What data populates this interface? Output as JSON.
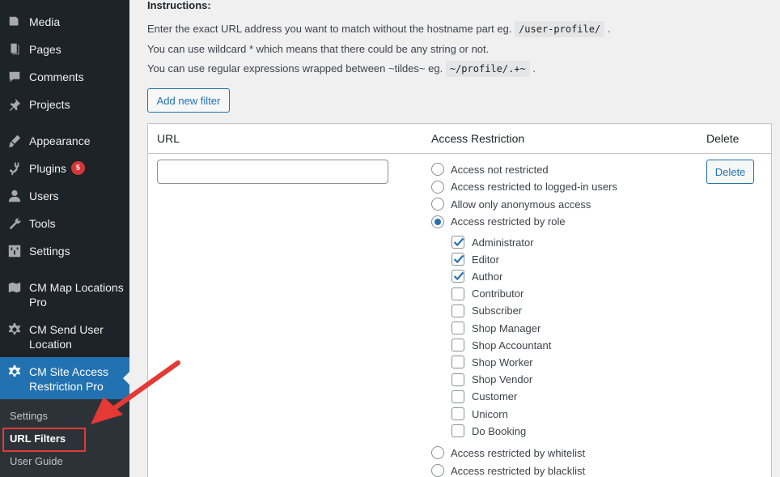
{
  "sidebar": {
    "items": [
      {
        "label": "Media",
        "icon": "media-icon"
      },
      {
        "label": "Pages",
        "icon": "pages-icon"
      },
      {
        "label": "Comments",
        "icon": "comments-icon"
      },
      {
        "label": "Projects",
        "icon": "pin-icon"
      },
      {
        "label": "Appearance",
        "icon": "brush-icon"
      },
      {
        "label": "Plugins",
        "icon": "plugin-icon",
        "badge": "5"
      },
      {
        "label": "Users",
        "icon": "user-icon"
      },
      {
        "label": "Tools",
        "icon": "wrench-icon"
      },
      {
        "label": "Settings",
        "icon": "settings-sliders-icon"
      },
      {
        "label": "CM Map Locations Pro",
        "icon": "map-icon"
      },
      {
        "label": "CM Send User Location",
        "icon": "gear-icon"
      },
      {
        "label": "CM Site Access Restriction Pro",
        "icon": "gear-icon"
      }
    ],
    "submenu": [
      {
        "label": "Settings"
      },
      {
        "label": "URL Filters"
      },
      {
        "label": "User Guide"
      }
    ]
  },
  "instructions": {
    "title": "Instructions:",
    "line1_text": "Enter the exact URL address you want to match without the hostname part eg.",
    "line1_code": "/user-profile/",
    "line1_end": ".",
    "line2": "You can use wildcard * which means that there could be any string or not.",
    "line3_text": "You can use regular expressions wrapped between ~tildes~ eg.",
    "line3_code": "~/profile/.+~",
    "line3_end": "."
  },
  "add_filter_label": "Add new filter",
  "table": {
    "headers": {
      "url": "URL",
      "access": "Access Restriction",
      "delete": "Delete"
    },
    "url_value": "",
    "delete_label": "Delete",
    "radios": [
      {
        "label": "Access not restricted",
        "checked": false
      },
      {
        "label": "Access restricted to logged-in users",
        "checked": false
      },
      {
        "label": "Allow only anonymous access",
        "checked": false
      },
      {
        "label": "Access restricted by role",
        "checked": true
      }
    ],
    "roles": [
      {
        "label": "Administrator",
        "checked": true
      },
      {
        "label": "Editor",
        "checked": true
      },
      {
        "label": "Author",
        "checked": true
      },
      {
        "label": "Contributor",
        "checked": false
      },
      {
        "label": "Subscriber",
        "checked": false
      },
      {
        "label": "Shop Manager",
        "checked": false
      },
      {
        "label": "Shop Accountant",
        "checked": false
      },
      {
        "label": "Shop Worker",
        "checked": false
      },
      {
        "label": "Shop Vendor",
        "checked": false
      },
      {
        "label": "Customer",
        "checked": false
      },
      {
        "label": "Unicorn",
        "checked": false
      },
      {
        "label": "Do Booking",
        "checked": false
      }
    ],
    "radios_after": [
      {
        "label": "Access restricted by whitelist",
        "checked": false
      },
      {
        "label": "Access restricted by blacklist",
        "checked": false
      }
    ]
  },
  "colors": {
    "accent": "#2271b1",
    "sidebar_bg": "#1d2327",
    "annotation": "#e53935"
  }
}
